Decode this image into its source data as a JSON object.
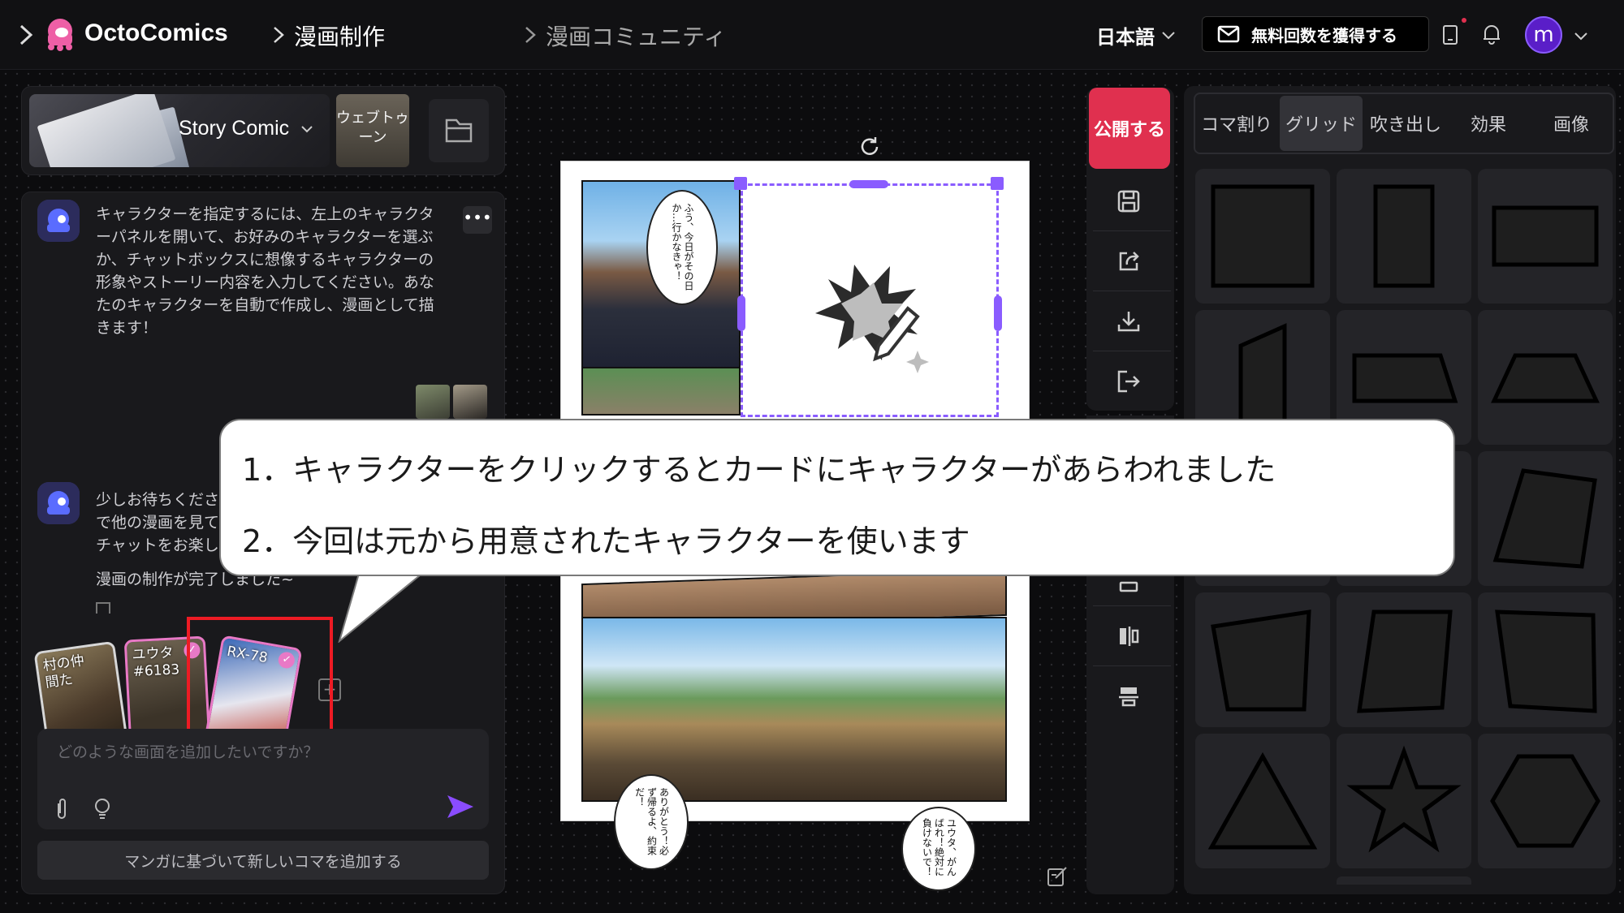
{
  "header": {
    "logo": "OctoComics",
    "nav_create": "漫画制作",
    "nav_community": "漫画コミュニティ",
    "language": "日本語",
    "reward_button": "無料回数を獲得する",
    "avatar_letter": "m"
  },
  "left": {
    "story_type": "Story Comic",
    "webtoon_label": "ウェブトゥーン",
    "messages": [
      {
        "text": "キャラクターを指定するには、左上のキャラクターパネルを開いて、お好みのキャラクターを選ぶか、チャットボックスに想像するキャラクターの形象やストーリー内容を入力してください。あなたのキャラクターを自動で作成し、漫画として描きます！"
      },
      {
        "text_visible_1": "少しお待ちくださ",
        "text_visible_2": "で他の漫画を見て",
        "text_visible_3": "チャットをお楽し",
        "done": "漫画の制作が完了しました~"
      }
    ],
    "cards": [
      {
        "label": "村の仲間た"
      },
      {
        "label": "ユウタ#6183"
      },
      {
        "label": "RX-78"
      }
    ],
    "input_placeholder": "どのような画面を追加したいですか？",
    "add_panel_button": "マンガに基づいて新しいコマを追加する"
  },
  "toolbar": {
    "publish": "公開する"
  },
  "shapes": {
    "tabs": [
      "コマ割り",
      "グリッド",
      "吹き出し",
      "効果",
      "画像"
    ],
    "active_tab": "グリッド"
  },
  "canvas": {
    "bubble1": "ふう、今日がその日か…行かなきゃ！",
    "bubble2": "ありがとう！必ず帰るよ、約束だ！",
    "bubble3": "ユウタ、がんばれ！絶対に負けないで！"
  },
  "callout": {
    "line1": "1．キャラクターをクリックするとカードにキャラクターがあらわれました",
    "line2": "2．今回は元から用意されたキャラクターを使います"
  },
  "colors": {
    "accent": "#e0304f",
    "avatar": "#5a1ec8",
    "highlight": "#ee1b24"
  }
}
